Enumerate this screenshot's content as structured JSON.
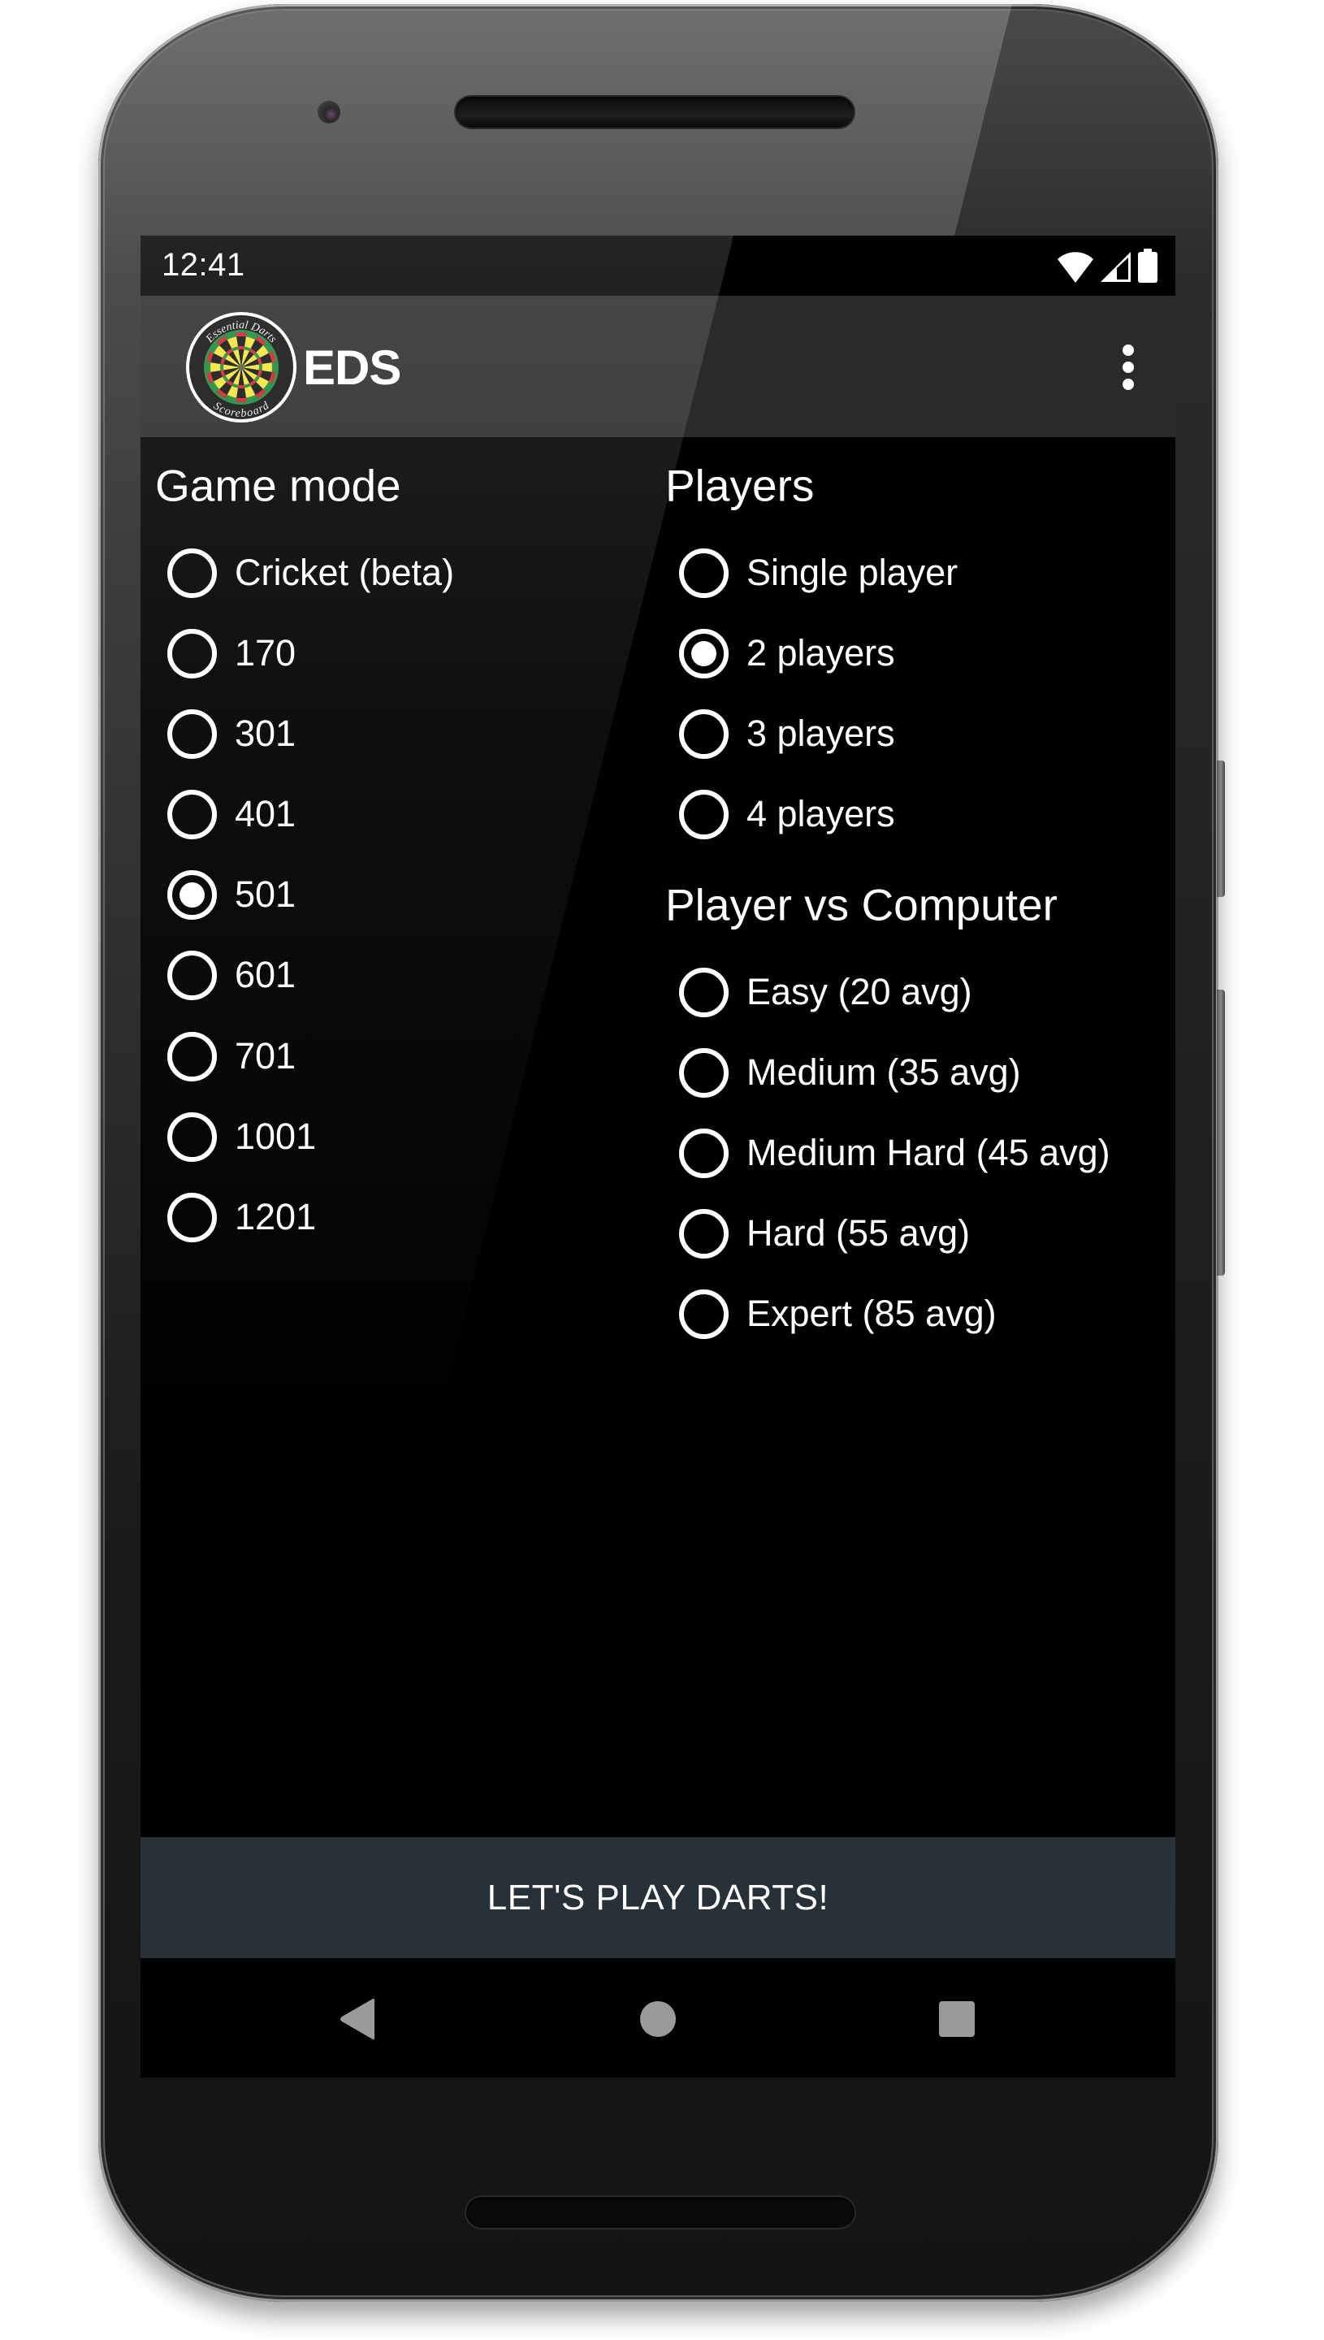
{
  "status_bar": {
    "time": "12:41",
    "icons": [
      "wifi-icon",
      "cellular-signal-icon",
      "battery-icon"
    ]
  },
  "app_bar": {
    "logo": {
      "top_text": "Essential Darts",
      "bottom_text": "Scoreboard"
    },
    "title": "EDS",
    "overflow_icon": "more-vert-icon"
  },
  "game_mode": {
    "heading": "Game mode",
    "selected": "501",
    "options": [
      "Cricket (beta)",
      "170",
      "301",
      "401",
      "501",
      "601",
      "701",
      "1001",
      "1201"
    ]
  },
  "players": {
    "heading": "Players",
    "selected": "2 players",
    "options": [
      "Single player",
      "2 players",
      "3 players",
      "4 players"
    ]
  },
  "player_vs_computer": {
    "heading": "Player vs Computer",
    "selected": null,
    "options": [
      "Easy (20 avg)",
      "Medium (35 avg)",
      "Medium Hard (45 avg)",
      "Hard (55 avg)",
      "Expert (85 avg)"
    ]
  },
  "action_button": {
    "label": "LET'S PLAY DARTS!"
  },
  "nav_bar": {
    "back_icon": "back-triangle-icon",
    "home_icon": "home-circle-icon",
    "recents_icon": "recents-square-icon"
  },
  "colors": {
    "app_bar": "#2a2a2a",
    "status_bar": "#000000",
    "content_background": "#000000",
    "action_button": "#263238",
    "nav_icons": "#9a9a9a",
    "text": "#ffffff"
  }
}
